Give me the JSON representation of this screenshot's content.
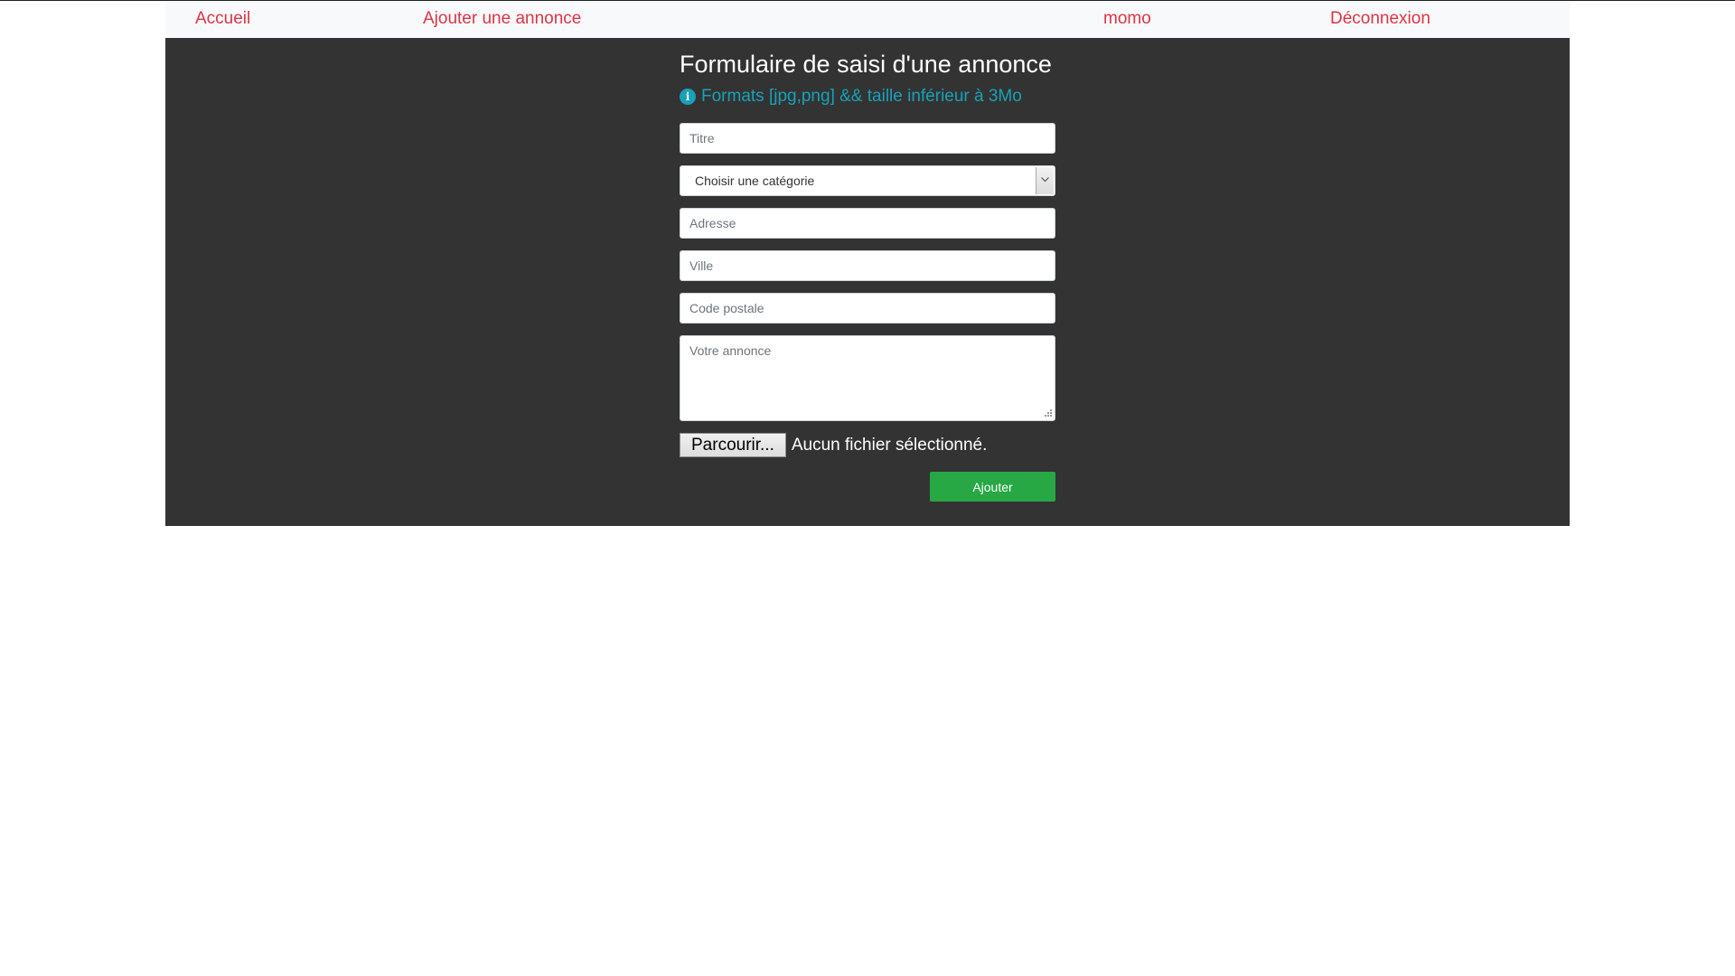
{
  "nav": {
    "home": "Accueil",
    "add_ad": "Ajouter une annonce",
    "user": "momo",
    "logout": "Déconnexion"
  },
  "form": {
    "title": "Formulaire de saisi d'une annonce",
    "info": "Formats [jpg,png] && taille inférieur à 3Mo",
    "info_icon": "info-circle-icon",
    "titre_placeholder": "Titre",
    "category_selected": "Choisir une catégorie",
    "adresse_placeholder": "Adresse",
    "ville_placeholder": "Ville",
    "code_postal_placeholder": "Code postale",
    "annonce_placeholder": "Votre annonce",
    "file_button": "Parcourir...",
    "file_status": "Aucun fichier sélectionné.",
    "submit": "Ajouter"
  },
  "colors": {
    "nav_link": "#dc3545",
    "navbar_bg": "#f8f9fa",
    "panel_bg": "#333333",
    "info": "#17a2b8",
    "submit_bg": "#28a745"
  }
}
